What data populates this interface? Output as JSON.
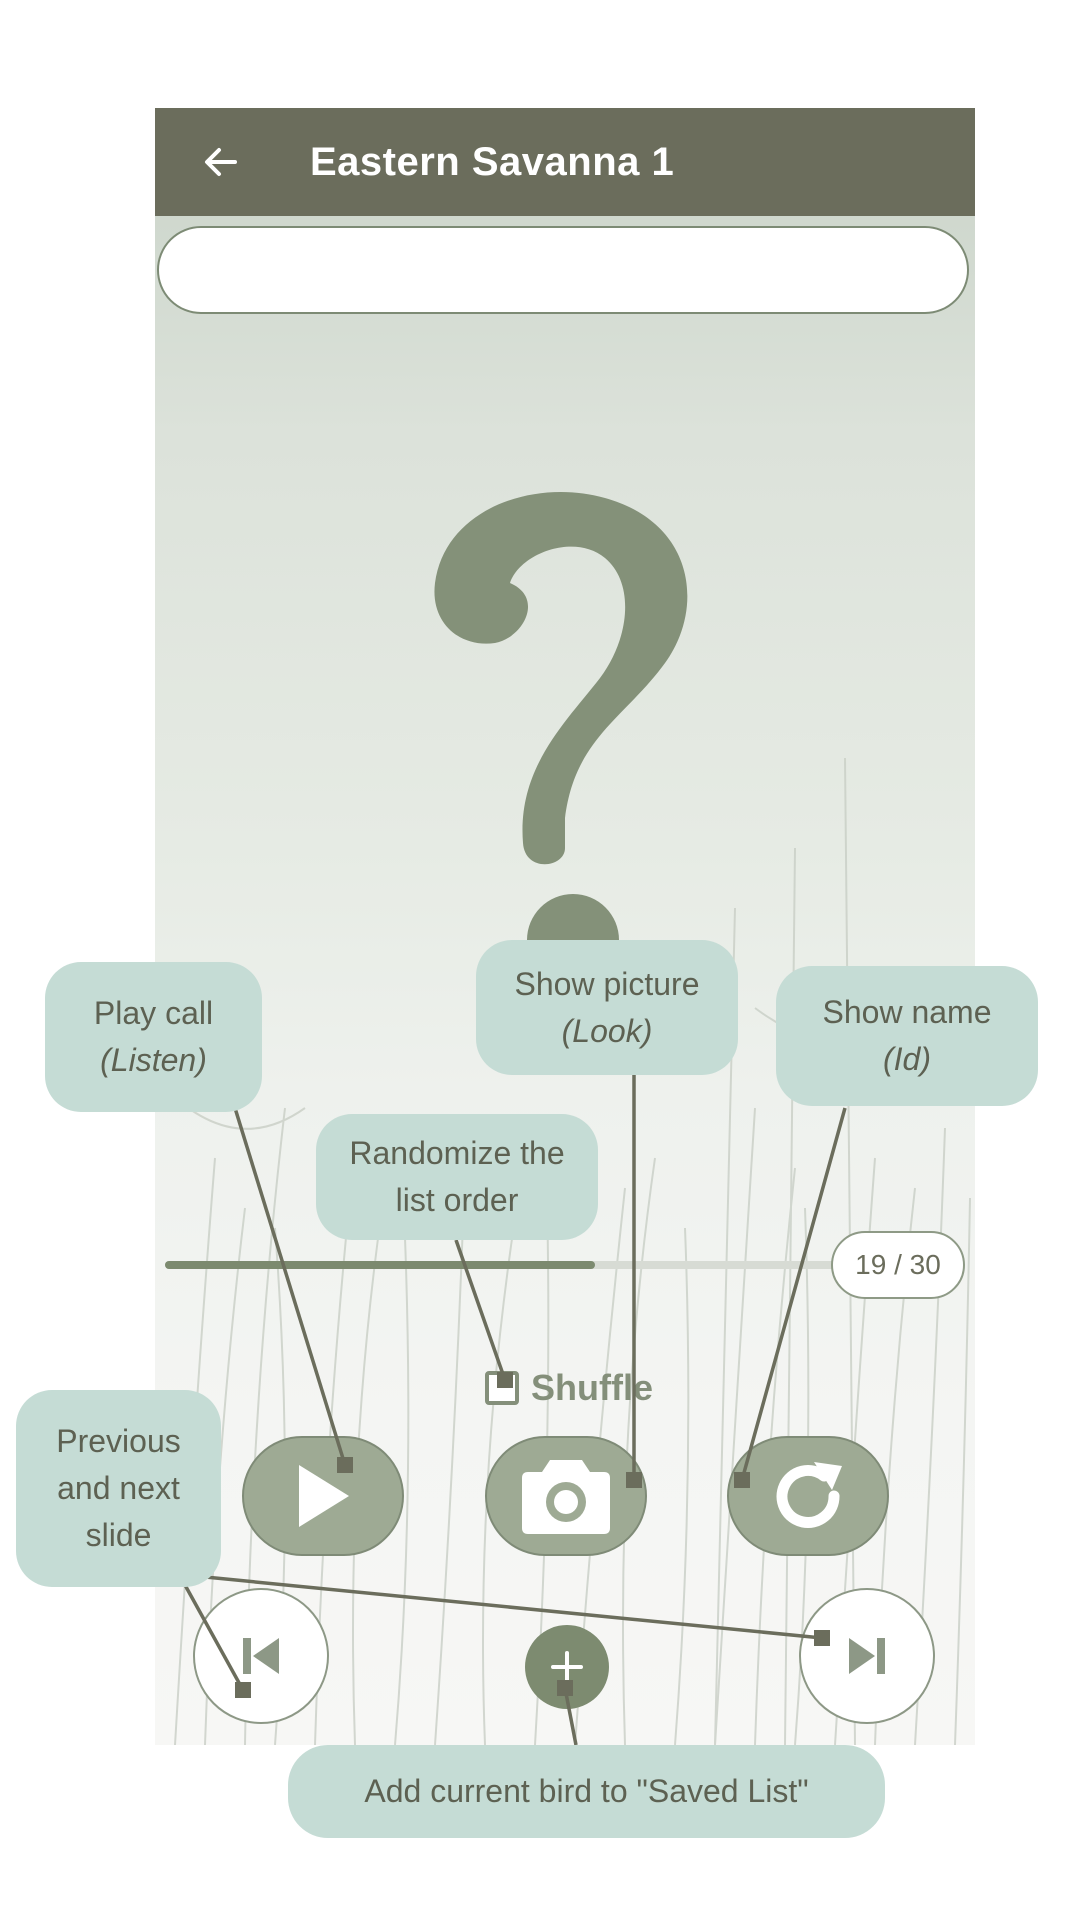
{
  "appbar": {
    "title": "Eastern Savanna 1",
    "back_icon": "arrow-left-icon"
  },
  "answer_field": {
    "value": "",
    "placeholder": ""
  },
  "progress": {
    "current": 19,
    "total": 30,
    "label": "19 / 30",
    "fraction": 0.633
  },
  "shuffle": {
    "label": "Shuffle",
    "checked": false
  },
  "actions": [
    {
      "name": "play-call",
      "icon": "play-icon"
    },
    {
      "name": "show-picture",
      "icon": "camera-icon"
    },
    {
      "name": "show-name",
      "icon": "refresh-icon"
    }
  ],
  "nav": {
    "previous_icon": "skip-previous-icon",
    "next_icon": "skip-next-icon",
    "add_icon": "plus-icon"
  },
  "annotations": {
    "play_call": {
      "line1": "Play call",
      "line2": "(Listen)"
    },
    "show_picture": {
      "line1": "Show picture",
      "line2": "(Look)"
    },
    "show_name": {
      "line1": "Show name",
      "line2": "(Id)"
    },
    "randomize": {
      "line1": "Randomize the",
      "line2": "list order"
    },
    "prev_next": {
      "line1": "Previous",
      "line2": "and next",
      "line3": "slide"
    },
    "add_bird": {
      "text": "Add current bird to \"Saved List\""
    }
  },
  "colors": {
    "appbar": "#6b6d5c",
    "accent": "#7c8a6f",
    "button_fill": "#9eaa94",
    "tooltip_bg": "#c5dcd5",
    "tooltip_text": "#5d6152",
    "connector": "#6b6d5c"
  }
}
